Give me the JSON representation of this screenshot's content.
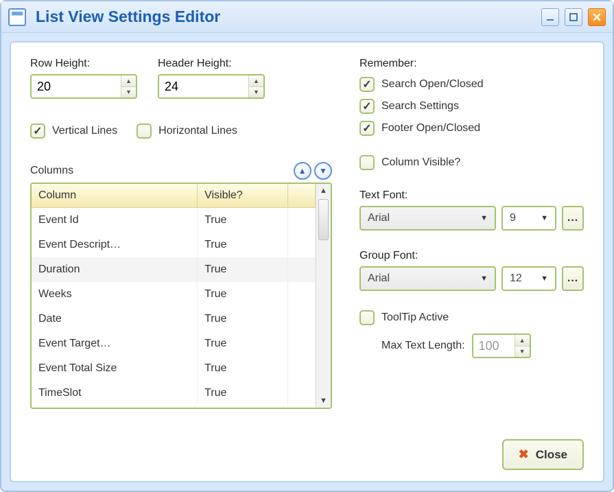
{
  "window": {
    "title": "List View Settings Editor"
  },
  "left": {
    "rowHeight": {
      "label": "Row Height:",
      "value": "20"
    },
    "headerHeight": {
      "label": "Header Height:",
      "value": "24"
    },
    "verticalLines": {
      "label": "Vertical Lines",
      "checked": true
    },
    "horizontalLines": {
      "label": "Horizontal Lines",
      "checked": false
    },
    "columnsLabel": "Columns",
    "table": {
      "headers": [
        "Column",
        "Visible?",
        ""
      ],
      "rows": [
        {
          "name": "Event Id",
          "visible": "True"
        },
        {
          "name": "Event Descript…",
          "visible": "True"
        },
        {
          "name": "Duration",
          "visible": "True"
        },
        {
          "name": "Weeks",
          "visible": "True"
        },
        {
          "name": "Date",
          "visible": "True"
        },
        {
          "name": "Event Target…",
          "visible": "True"
        },
        {
          "name": "Event Total Size",
          "visible": "True"
        },
        {
          "name": "TimeSlot",
          "visible": "True"
        }
      ]
    }
  },
  "right": {
    "rememberLabel": "Remember:",
    "remember": [
      {
        "label": "Search Open/Closed",
        "checked": true
      },
      {
        "label": "Search Settings",
        "checked": true
      },
      {
        "label": "Footer Open/Closed",
        "checked": true
      }
    ],
    "columnVisible": {
      "label": "Column Visible?",
      "checked": false
    },
    "textFont": {
      "label": "Text Font:",
      "name": "Arial",
      "size": "9"
    },
    "groupFont": {
      "label": "Group Font:",
      "name": "Arial",
      "size": "12"
    },
    "tooltip": {
      "label": "ToolTip Active",
      "checked": false,
      "maxLabel": "Max Text Length:",
      "maxValue": "100"
    }
  },
  "footer": {
    "closeLabel": "Close"
  }
}
